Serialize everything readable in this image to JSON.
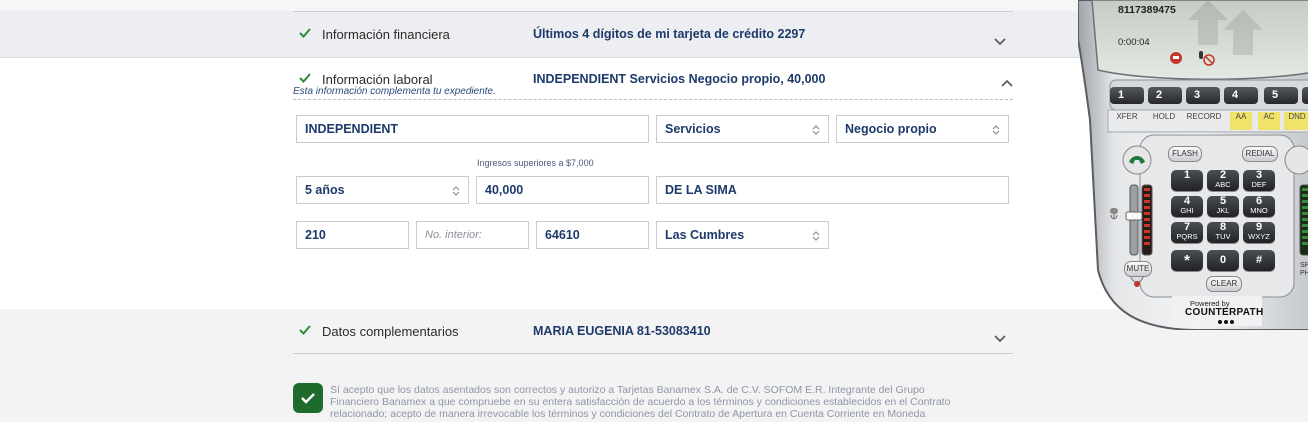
{
  "sections": {
    "financial": {
      "title": "Información financiera",
      "value": "Últimos 4 dígitos de mi tarjeta de crédito 2297"
    },
    "labor": {
      "title": "Información laboral",
      "value": "INDEPENDIENT Servicios Negocio propio, 40,000",
      "note": "Esta información complementa tu expediente."
    },
    "complementary": {
      "title": "Datos complementarios",
      "value": "MARIA EUGENIA 81-53083410"
    }
  },
  "form": {
    "employment_type": "INDEPENDIENT",
    "sector": "Servicios",
    "business": "Negocio propio",
    "income_helper": "Ingresos superiores a $7,000",
    "seniority": "5 años",
    "income": "40,000",
    "street": "DE LA SIMA",
    "ext_number": "210",
    "int_number_placeholder": "No. interior:",
    "postal_code": "64610",
    "neighborhood": "Las Cumbres"
  },
  "terms": {
    "text": "Sí acepto que los datos asentados son correctos y autorizo a Tarjetas Banamex S.A. de C.V. SOFOM E.R. Integrante del Grupo Financiero Banamex a que compruebe en su entera satisfacción de acuerdo a los términos y condiciones establecidos en el Contrato relacionado; acepto de manera irrevocable los términos y condiciones del Contrato de Apertura en Cuenta Corriente en Moneda"
  },
  "softphone": {
    "number": "8117389475",
    "timer": "0:00:04",
    "line_buttons": [
      "1",
      "2",
      "3",
      "4",
      "5"
    ],
    "function_buttons": [
      "XFER",
      "HOLD",
      "RECORD",
      "AA",
      "AC",
      "DND"
    ],
    "flash_label": "FLASH",
    "redial_label": "REDIAL",
    "mute_label": "MUTE",
    "speaker_label": "SPEA PHO",
    "clear_label": "CLEAR",
    "keys": [
      {
        "d": "1",
        "l": ""
      },
      {
        "d": "2",
        "l": "ABC"
      },
      {
        "d": "3",
        "l": "DEF"
      },
      {
        "d": "4",
        "l": "GHI"
      },
      {
        "d": "5",
        "l": "JKL"
      },
      {
        "d": "6",
        "l": "MNO"
      },
      {
        "d": "7",
        "l": "PQRS"
      },
      {
        "d": "8",
        "l": "TUV"
      },
      {
        "d": "9",
        "l": "WXYZ"
      },
      {
        "d": "*",
        "l": ""
      },
      {
        "d": "0",
        "l": ""
      },
      {
        "d": "#",
        "l": ""
      }
    ],
    "powered_by": "Powered by",
    "brand": "COUNTERPATH"
  },
  "colors": {
    "accent_green": "#1f6b2e",
    "check_green": "#2e8b3a",
    "value_blue": "#1d3a6b"
  }
}
